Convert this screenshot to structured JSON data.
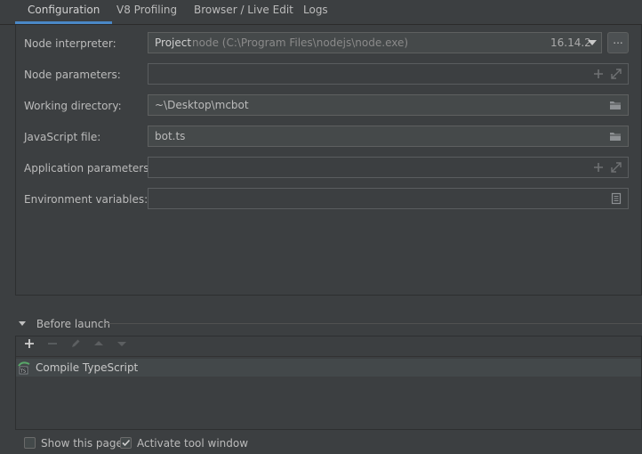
{
  "tabs": [
    {
      "label": "Configuration",
      "active": true
    },
    {
      "label": "V8 Profiling",
      "active": false
    },
    {
      "label": "Browser / Live Edit",
      "active": false
    },
    {
      "label": "Logs",
      "active": false
    }
  ],
  "fields": {
    "node_interpreter": {
      "label": "Node interpreter:",
      "prefix": "Project",
      "path": "node (C:\\Program Files\\nodejs\\node.exe)",
      "version": "16.14.2",
      "browse_label": "..."
    },
    "node_parameters": {
      "label": "Node parameters:",
      "value": ""
    },
    "working_directory": {
      "label": "Working directory:",
      "value": "~\\Desktop\\mcbot"
    },
    "javascript_file": {
      "label": "JavaScript file:",
      "value": "bot.ts"
    },
    "application_parameters": {
      "label": "Application parameters:",
      "value": ""
    },
    "environment_variables": {
      "label": "Environment variables:",
      "value": ""
    }
  },
  "before_launch": {
    "title": "Before launch",
    "items": [
      {
        "label": "Compile TypeScript",
        "icon": "typescript-compile-icon"
      }
    ],
    "toolbar": [
      "add-icon",
      "remove-icon",
      "edit-icon",
      "move-up-icon",
      "move-down-icon"
    ]
  },
  "options": {
    "show_this_page": {
      "label": "Show this page",
      "checked": false
    },
    "activate_tool_window": {
      "label": "Activate tool window",
      "checked": true
    }
  },
  "colors": {
    "background": "#3c3f41",
    "active_tab_underline": "#4a88c7",
    "field_background": "#45494a"
  }
}
